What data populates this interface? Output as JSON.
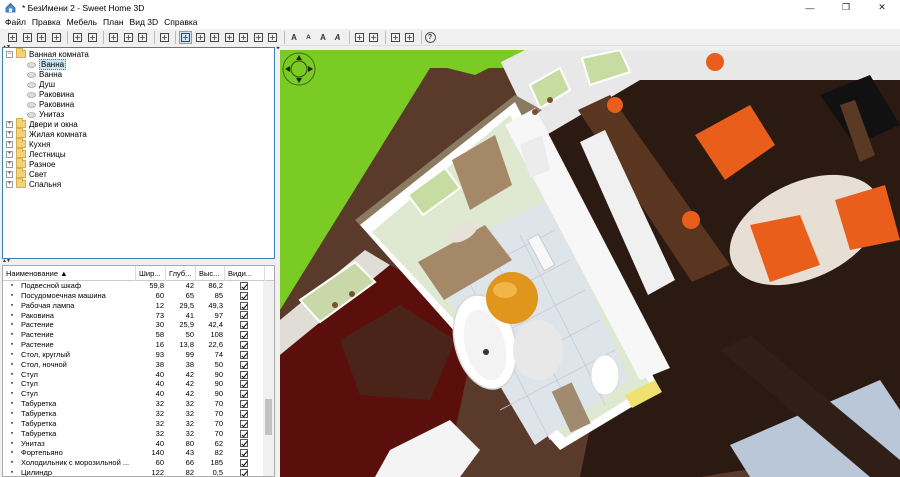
{
  "window": {
    "title": "* БезИмени 2 - Sweet Home 3D",
    "minimize_label": "—",
    "maximize_label": "❐",
    "close_label": "✕"
  },
  "menu": [
    "Файл",
    "Правка",
    "Мебель",
    "План",
    "Вид 3D",
    "Справка"
  ],
  "toolbar": {
    "icons": [
      "new-home-icon",
      "open-icon",
      "save-icon",
      "cut-icon",
      "sep",
      "undo-icon",
      "redo-icon",
      "sep",
      "scissors-icon",
      "copy-icon",
      "paste-icon",
      "sep",
      "add-furniture-icon",
      "sep",
      "select-icon",
      "pan-icon",
      "create-walls-icon",
      "create-rooms-icon",
      "create-polylines-icon",
      "create-dimensions-icon",
      "create-labels-icon",
      "sep",
      "text-increase-icon",
      "text-decrease-icon",
      "bold-icon",
      "italic-icon",
      "sep",
      "zoom-in-icon",
      "zoom-out-icon",
      "sep",
      "top-view-icon",
      "virtual-visit-icon",
      "sep",
      "help-icon"
    ],
    "glyphs": {
      "text-increase-icon": "A",
      "text-decrease-icon": "A",
      "bold-icon": "A",
      "italic-icon": "A",
      "help-icon": "?"
    }
  },
  "catalog": {
    "groups": [
      {
        "label": "Ванная комната",
        "expanded": true,
        "items": [
          {
            "label": "Ванна",
            "selected": true,
            "icon": "bathtub-icon"
          },
          {
            "label": "Ванна",
            "selected": false,
            "icon": "bathtub-icon"
          },
          {
            "label": "Душ",
            "selected": false,
            "icon": "shower-icon"
          },
          {
            "label": "Раковина",
            "selected": false,
            "icon": "sink-icon"
          },
          {
            "label": "Раковина",
            "selected": false,
            "icon": "sink-icon"
          },
          {
            "label": "Унитаз",
            "selected": false,
            "icon": "toilet-icon"
          }
        ]
      },
      {
        "label": "Двери и окна",
        "expanded": false
      },
      {
        "label": "Жилая комната",
        "expanded": false
      },
      {
        "label": "Кухня",
        "expanded": false
      },
      {
        "label": "Лестницы",
        "expanded": false
      },
      {
        "label": "Разное",
        "expanded": false
      },
      {
        "label": "Свет",
        "expanded": false
      },
      {
        "label": "Спальня",
        "expanded": false
      }
    ]
  },
  "furniture_table": {
    "columns": [
      "Наименование ▲",
      "Шир...",
      "Глуб...",
      "Выс...",
      "Види..."
    ],
    "rows": [
      {
        "name": "Подвесной шкаф",
        "w": "59,8",
        "d": "42",
        "h": "86,2",
        "visible": true
      },
      {
        "name": "Посудомоечная машина",
        "w": "60",
        "d": "65",
        "h": "85",
        "visible": true
      },
      {
        "name": "Рабочая лампа",
        "w": "12",
        "d": "29,5",
        "h": "49,3",
        "visible": true
      },
      {
        "name": "Раковина",
        "w": "73",
        "d": "41",
        "h": "97",
        "visible": true
      },
      {
        "name": "Растение",
        "w": "30",
        "d": "25,9",
        "h": "42,4",
        "visible": true
      },
      {
        "name": "Растение",
        "w": "58",
        "d": "50",
        "h": "108",
        "visible": true
      },
      {
        "name": "Растение",
        "w": "16",
        "d": "13,8",
        "h": "22,6",
        "visible": true
      },
      {
        "name": "Стол, круглый",
        "w": "93",
        "d": "99",
        "h": "74",
        "visible": true
      },
      {
        "name": "Стол, ночной",
        "w": "38",
        "d": "38",
        "h": "50",
        "visible": true
      },
      {
        "name": "Стул",
        "w": "40",
        "d": "42",
        "h": "90",
        "visible": true
      },
      {
        "name": "Стул",
        "w": "40",
        "d": "42",
        "h": "90",
        "visible": true
      },
      {
        "name": "Стул",
        "w": "40",
        "d": "42",
        "h": "90",
        "visible": true
      },
      {
        "name": "Табуретка",
        "w": "32",
        "d": "32",
        "h": "70",
        "visible": true
      },
      {
        "name": "Табуретка",
        "w": "32",
        "d": "32",
        "h": "70",
        "visible": true
      },
      {
        "name": "Табуретка",
        "w": "32",
        "d": "32",
        "h": "70",
        "visible": true
      },
      {
        "name": "Табуретка",
        "w": "32",
        "d": "32",
        "h": "70",
        "visible": true
      },
      {
        "name": "Унитаз",
        "w": "40",
        "d": "80",
        "h": "62",
        "visible": true
      },
      {
        "name": "Фортепьяно",
        "w": "140",
        "d": "43",
        "h": "82",
        "visible": true
      },
      {
        "name": "Холодильник с морозильной ...",
        "w": "60",
        "d": "66",
        "h": "185",
        "visible": true
      },
      {
        "name": "Цилиндр",
        "w": "122",
        "d": "82",
        "h": "0,5",
        "visible": true
      }
    ]
  },
  "colors": {
    "grass": "#7acb24",
    "wall": "#ffffff",
    "floor_dark": "#2a1a12",
    "bath_floor": "#dde4ea",
    "accent_orange": "#e8641a",
    "selection": "#cce4f7",
    "panel_border": "#3c7fb1"
  }
}
